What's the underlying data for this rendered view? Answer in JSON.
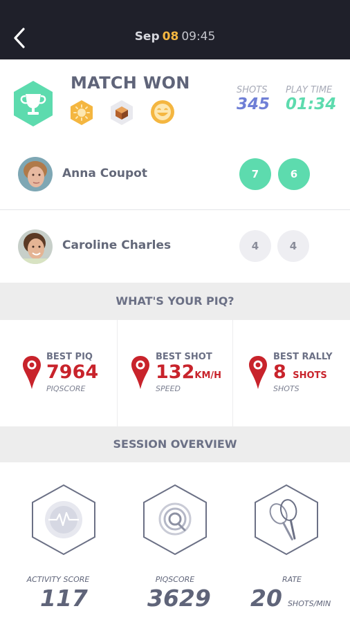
{
  "header": {
    "month": "Sep",
    "day": "08",
    "time": "09:45"
  },
  "result": {
    "title": "MATCH WON",
    "badges": [
      "sun-badge-icon",
      "cube-badge-icon",
      "smiley-badge-icon"
    ],
    "shots_label": "SHOTS",
    "shots_value": "345",
    "playtime_label": "PLAY TIME",
    "playtime_value": "01:34"
  },
  "players": [
    {
      "name": "Anna Coupot",
      "sets": [
        "7",
        "6"
      ],
      "winner": true
    },
    {
      "name": "Caroline Charles",
      "sets": [
        "4",
        "4"
      ],
      "winner": false
    }
  ],
  "piq_section": {
    "title": "WHAT'S YOUR PIQ?",
    "best_piq": {
      "label": "BEST PIQ",
      "value": "7964",
      "sub": "PIQSCORE"
    },
    "best_shot": {
      "label": "BEST SHOT",
      "value": "132",
      "unit": "KM/H",
      "sub": "SPEED"
    },
    "best_rally": {
      "label": "BEST RALLY",
      "value": "8",
      "unit": "SHOTS",
      "sub": "SHOTS"
    }
  },
  "overview": {
    "title": "SESSION OVERVIEW",
    "activity": {
      "label": "ACTIVITY SCORE",
      "value": "117",
      "icon": "activity-pulse-icon"
    },
    "piqscore": {
      "label": "PIQSCORE",
      "value": "3629",
      "icon": "piq-target-icon"
    },
    "rate": {
      "label": "RATE",
      "value": "20",
      "unit": "SHOTS/MIN",
      "icon": "racket-icon"
    }
  },
  "colors": {
    "topbar": "#1f202a",
    "accent_green": "#5ddbae",
    "accent_blue": "#6f7fd6",
    "accent_red": "#c8232b",
    "accent_orange": "#f4b640"
  }
}
